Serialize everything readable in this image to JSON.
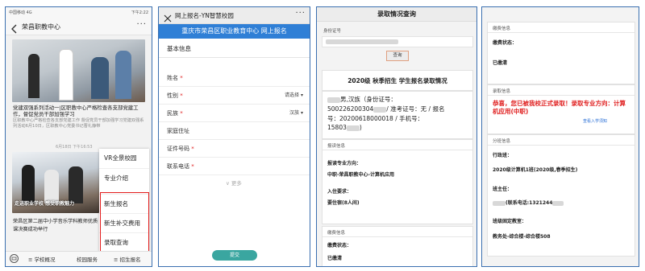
{
  "panel1": {
    "status_left": "中国移动 4G",
    "status_time": "下午2:22",
    "title": "荣昌职教中心",
    "back_icon": "chevron-left-icon",
    "more_icon": "more-dots-icon",
    "article1_title": "党建双强系列活动一|区职教中心严格检查各支部党建工作，督促党员干部加强学习",
    "article1_desc": "区职教中心严格检查各支部党建工作 督促党员干部加强学习党建双强系列活动6月10日，区职教中心党委书记曹礼静带",
    "timestamp": "6月18日 下午16:53",
    "photo_caption": "走进职业学校 感受职教魅力",
    "article2_title": "荣昌区第二届中小学音乐学科教师优质课决赛成功举行",
    "menu_items": [
      "VR全景校园",
      "专业介绍",
      "新生报名",
      "新生补交费用",
      "录取查询"
    ],
    "tabs": [
      "学校概况",
      "校园服务",
      "招生报名"
    ],
    "keyboard_icon": "keyboard-icon"
  },
  "panel2": {
    "title": "网上报名-YN智慧校园",
    "close_icon": "close-icon",
    "banner": "重庆市荣昌区职业教育中心 网上报名",
    "section": "基本信息",
    "fields": [
      {
        "label": "姓名",
        "required": "*",
        "select": ""
      },
      {
        "label": "性别",
        "required": "*",
        "select": "请选择"
      },
      {
        "label": "民族",
        "required": "*",
        "select": "汉族"
      },
      {
        "label": "家庭住址",
        "required": "",
        "select": ""
      },
      {
        "label": "证件号码",
        "required": "*",
        "select": ""
      },
      {
        "label": "联系电话",
        "required": "*",
        "select": ""
      }
    ],
    "more_label": "更多",
    "submit_label": "提交"
  },
  "panel3": {
    "title": "录取情况查询",
    "id_label": "身份证号",
    "query_button": "查询",
    "heading": "2020级 秋季招生 学生报名录取情况",
    "line1": "男,汉族（身份证号：",
    "line2": "500226200304",
    "line2b": "/ 准考证号：无 / 报名",
    "line3": "号：20200618000018 / 手机号：",
    "line4": "15803",
    "line4b": ")",
    "report_label": "报读信息",
    "major_label": "报读专业方向：",
    "major_value": "中职-荣昌职教中心-计算机应用",
    "dorm_label": "入住要求：",
    "dorm_value": "要住宿(8人间)",
    "fee_label": "缴费信息",
    "fee_status_label": "缴费状态：",
    "fee_status_value": "已缴清"
  },
  "panel4": {
    "fee_label": "缴费信息",
    "fee_status_label": "缴费状态：",
    "fee_status_value": "已缴清",
    "admit_label": "录取信息",
    "admit_text": "恭喜，您已被我校正式录取！录取专业方向：计算机应用(中职)",
    "admit_link": "查看入学须知",
    "class_label": "分班信息",
    "admin_class_label": "行政班：",
    "admin_class_value": "2020级计算机1班(2020级,春季招生)",
    "teacher_label": "班主任：",
    "teacher_value": "(联系电话:1321244",
    "classroom_label": "班级固定教室：",
    "classroom_value": "教务处-综合楼-综合楼508"
  },
  "colors": {
    "frame_border": "#3a6fb0",
    "banner_blue": "#2f7fd6",
    "highlight_red": "#e21b1b",
    "submit_teal": "#3aa6a0"
  }
}
